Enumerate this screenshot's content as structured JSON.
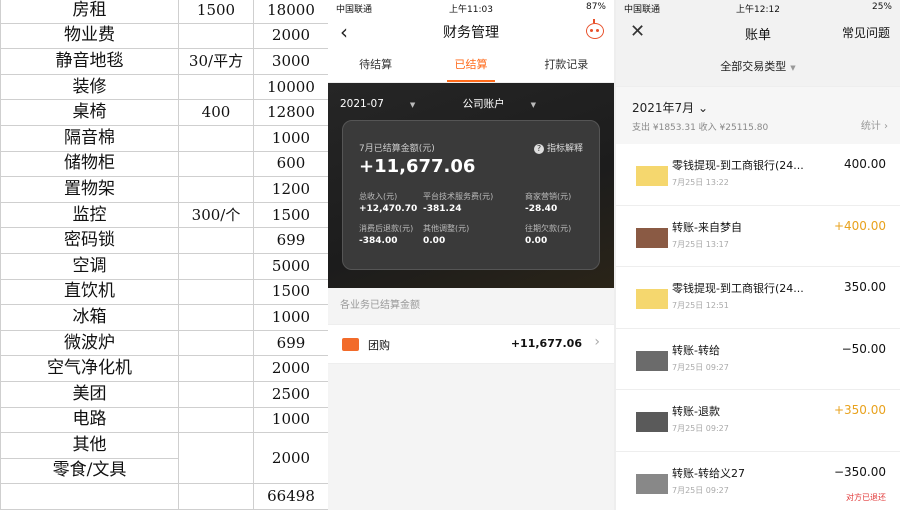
{
  "sheet": {
    "rows": [
      {
        "name": "房租",
        "unit": "1500",
        "amount": "18000"
      },
      {
        "name": "物业费",
        "unit": "",
        "amount": "2000"
      },
      {
        "name": "静音地毯",
        "unit": "30/平方",
        "amount": "3000"
      },
      {
        "name": "装修",
        "unit": "",
        "amount": "10000"
      },
      {
        "name": "桌椅",
        "unit": "400",
        "amount": "12800"
      },
      {
        "name": "隔音棉",
        "unit": "",
        "amount": "1000"
      },
      {
        "name": "储物柜",
        "unit": "",
        "amount": "600"
      },
      {
        "name": "置物架",
        "unit": "",
        "amount": "1200"
      },
      {
        "name": "监控",
        "unit": "300/个",
        "amount": "1500"
      },
      {
        "name": "密码锁",
        "unit": "",
        "amount": "699"
      },
      {
        "name": "空调",
        "unit": "",
        "amount": "5000"
      },
      {
        "name": "直饮机",
        "unit": "",
        "amount": "1500"
      },
      {
        "name": "冰箱",
        "unit": "",
        "amount": "1000"
      },
      {
        "name": "微波炉",
        "unit": "",
        "amount": "699"
      },
      {
        "name": "空气净化机",
        "unit": "",
        "amount": "2000"
      },
      {
        "name": "美团",
        "unit": "",
        "amount": "2500"
      },
      {
        "name": "电路",
        "unit": "",
        "amount": "1000"
      }
    ],
    "merged_names": [
      "其他",
      "零食/文具"
    ],
    "merged_amount": "2000",
    "total": "66498"
  },
  "finance": {
    "status": {
      "carrier": "中国联通",
      "time": "上午11:03",
      "battery": "87%"
    },
    "title": "财务管理",
    "tabs": [
      "待结算",
      "已结算",
      "打款记录"
    ],
    "filter_month": "2021-07",
    "filter_account": "公司账户",
    "card": {
      "label": "7月已结算金额(元)",
      "amount": "+11,677.06",
      "help": "指标解释",
      "stats": [
        {
          "label": "总收入(元)",
          "value": "+12,470.70"
        },
        {
          "label": "平台技术服务费(元)",
          "value": "-381.24"
        },
        {
          "label": "商家营销(元)",
          "value": "-28.40"
        },
        {
          "label": "消费后退款(元)",
          "value": "-384.00"
        },
        {
          "label": "其他调整(元)",
          "value": "0.00"
        },
        {
          "label": "往期欠款(元)",
          "value": "0.00"
        }
      ]
    },
    "section_title": "各业务已结算金额",
    "business": {
      "name": "团购",
      "amount": "+11,677.06"
    },
    "colors": {
      "accent": "#ff6a1a"
    }
  },
  "bill": {
    "status": {
      "carrier": "中国联通",
      "time": "上午12:12",
      "battery": "25%"
    },
    "title": "账单",
    "faq": "常见问题",
    "type_filter": "全部交易类型",
    "month": "2021年7月",
    "summary": "支出 ¥1853.31 收入 ¥25115.80",
    "stats_link": "统计",
    "transactions": [
      {
        "title": "零钱提现-到工商银行(24...",
        "date": "7月25日 13:22",
        "amount": "400.00",
        "note": "",
        "avatar": "#f5d76e"
      },
      {
        "title": "转账-来自梦自",
        "date": "7月25日 13:17",
        "amount": "+400.00",
        "note": "",
        "avatar": "#8a5a44"
      },
      {
        "title": "零钱提现-到工商银行(24...",
        "date": "7月25日 12:51",
        "amount": "350.00",
        "note": "",
        "avatar": "#f5d76e"
      },
      {
        "title": "转账-转给",
        "date": "7月25日 09:27",
        "amount": "−50.00",
        "note": "",
        "avatar": "#6b6b6b"
      },
      {
        "title": "转账-退款",
        "date": "7月25日 09:27",
        "amount": "+350.00",
        "note": "",
        "avatar": "#5a5a5a"
      },
      {
        "title": "转账-转给义27",
        "date": "7月25日 09:27",
        "amount": "−350.00",
        "note": "对方已退还",
        "avatar": "#888888"
      }
    ]
  }
}
